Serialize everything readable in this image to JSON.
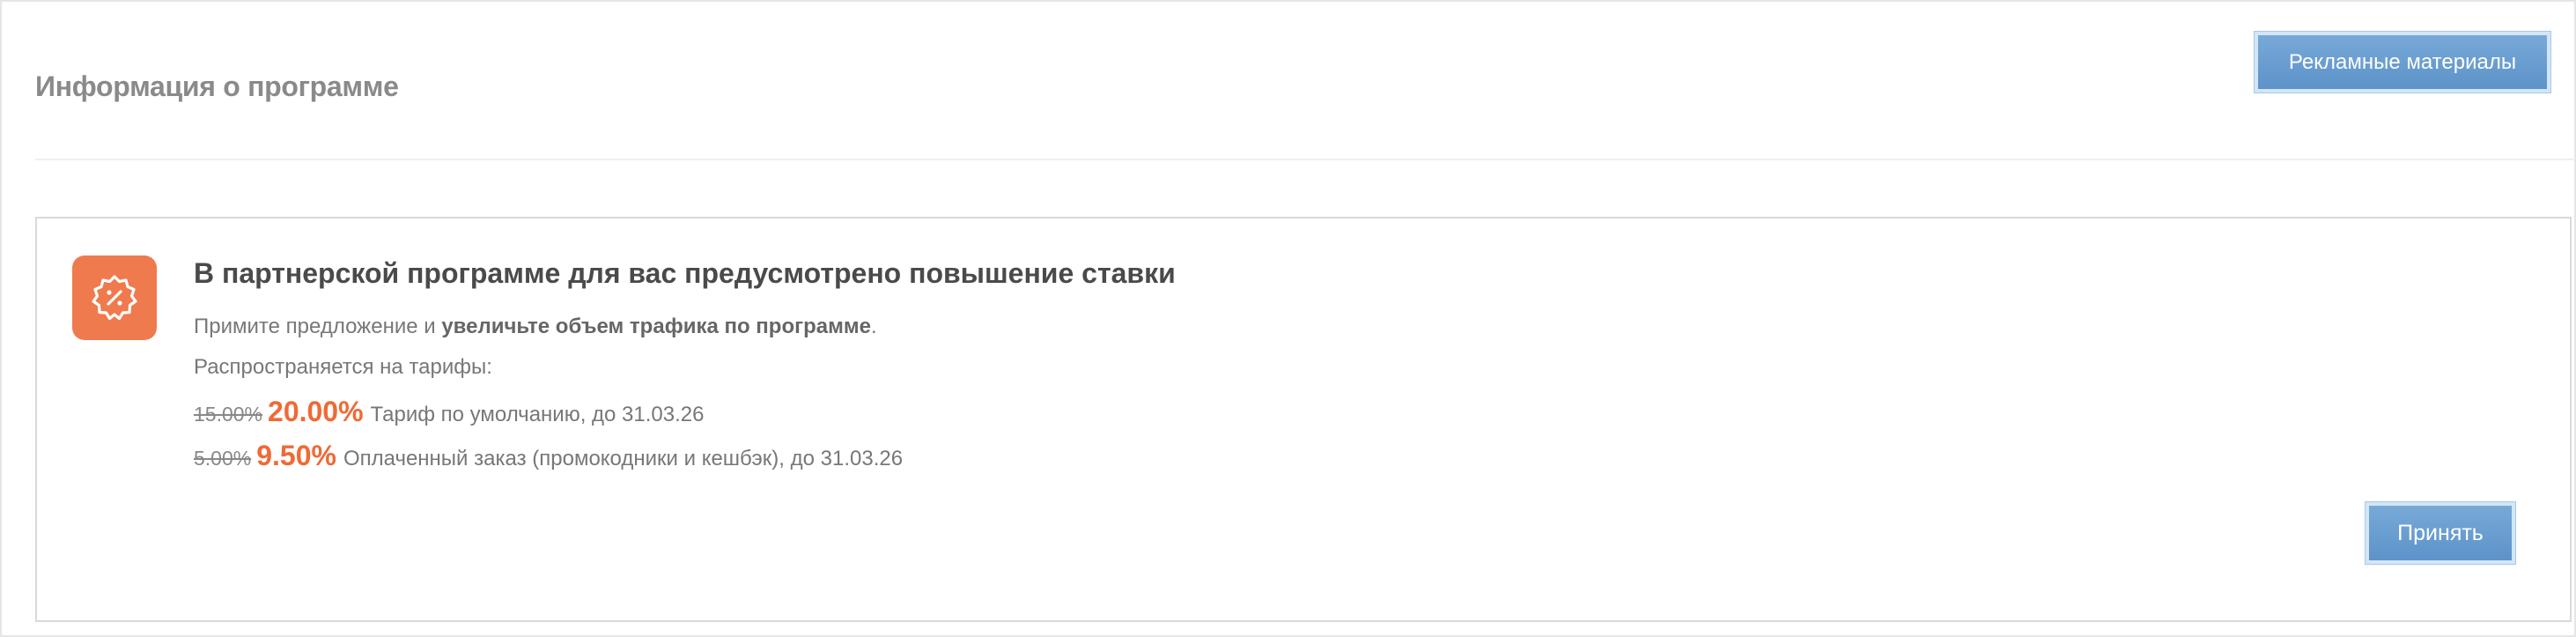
{
  "header": {
    "title": "Информация о программе",
    "materials_button": "Рекламные материалы"
  },
  "offer": {
    "icon": "discount-badge-icon",
    "heading": "В партнерской программе для вас предусмотрено повышение ставки",
    "description_prefix": "Примите предложение и ",
    "description_bold": "увеличьте объем трафика по программе",
    "description_suffix": ".",
    "applies_label": "Распространяется на тарифы:",
    "rates": [
      {
        "old": "15.00%",
        "new": "20.00%",
        "description": "Тариф по умолчанию, до 31.03.26"
      },
      {
        "old": "5.00%",
        "new": "9.50%",
        "description": "Оплаченный заказ (промокодники и кешбэк), до 31.03.26"
      }
    ],
    "accept_button": "Принять"
  },
  "colors": {
    "accent_orange": "#ef7a4e",
    "rate_orange": "#ef6a36",
    "button_blue": "#6a9fd2"
  }
}
